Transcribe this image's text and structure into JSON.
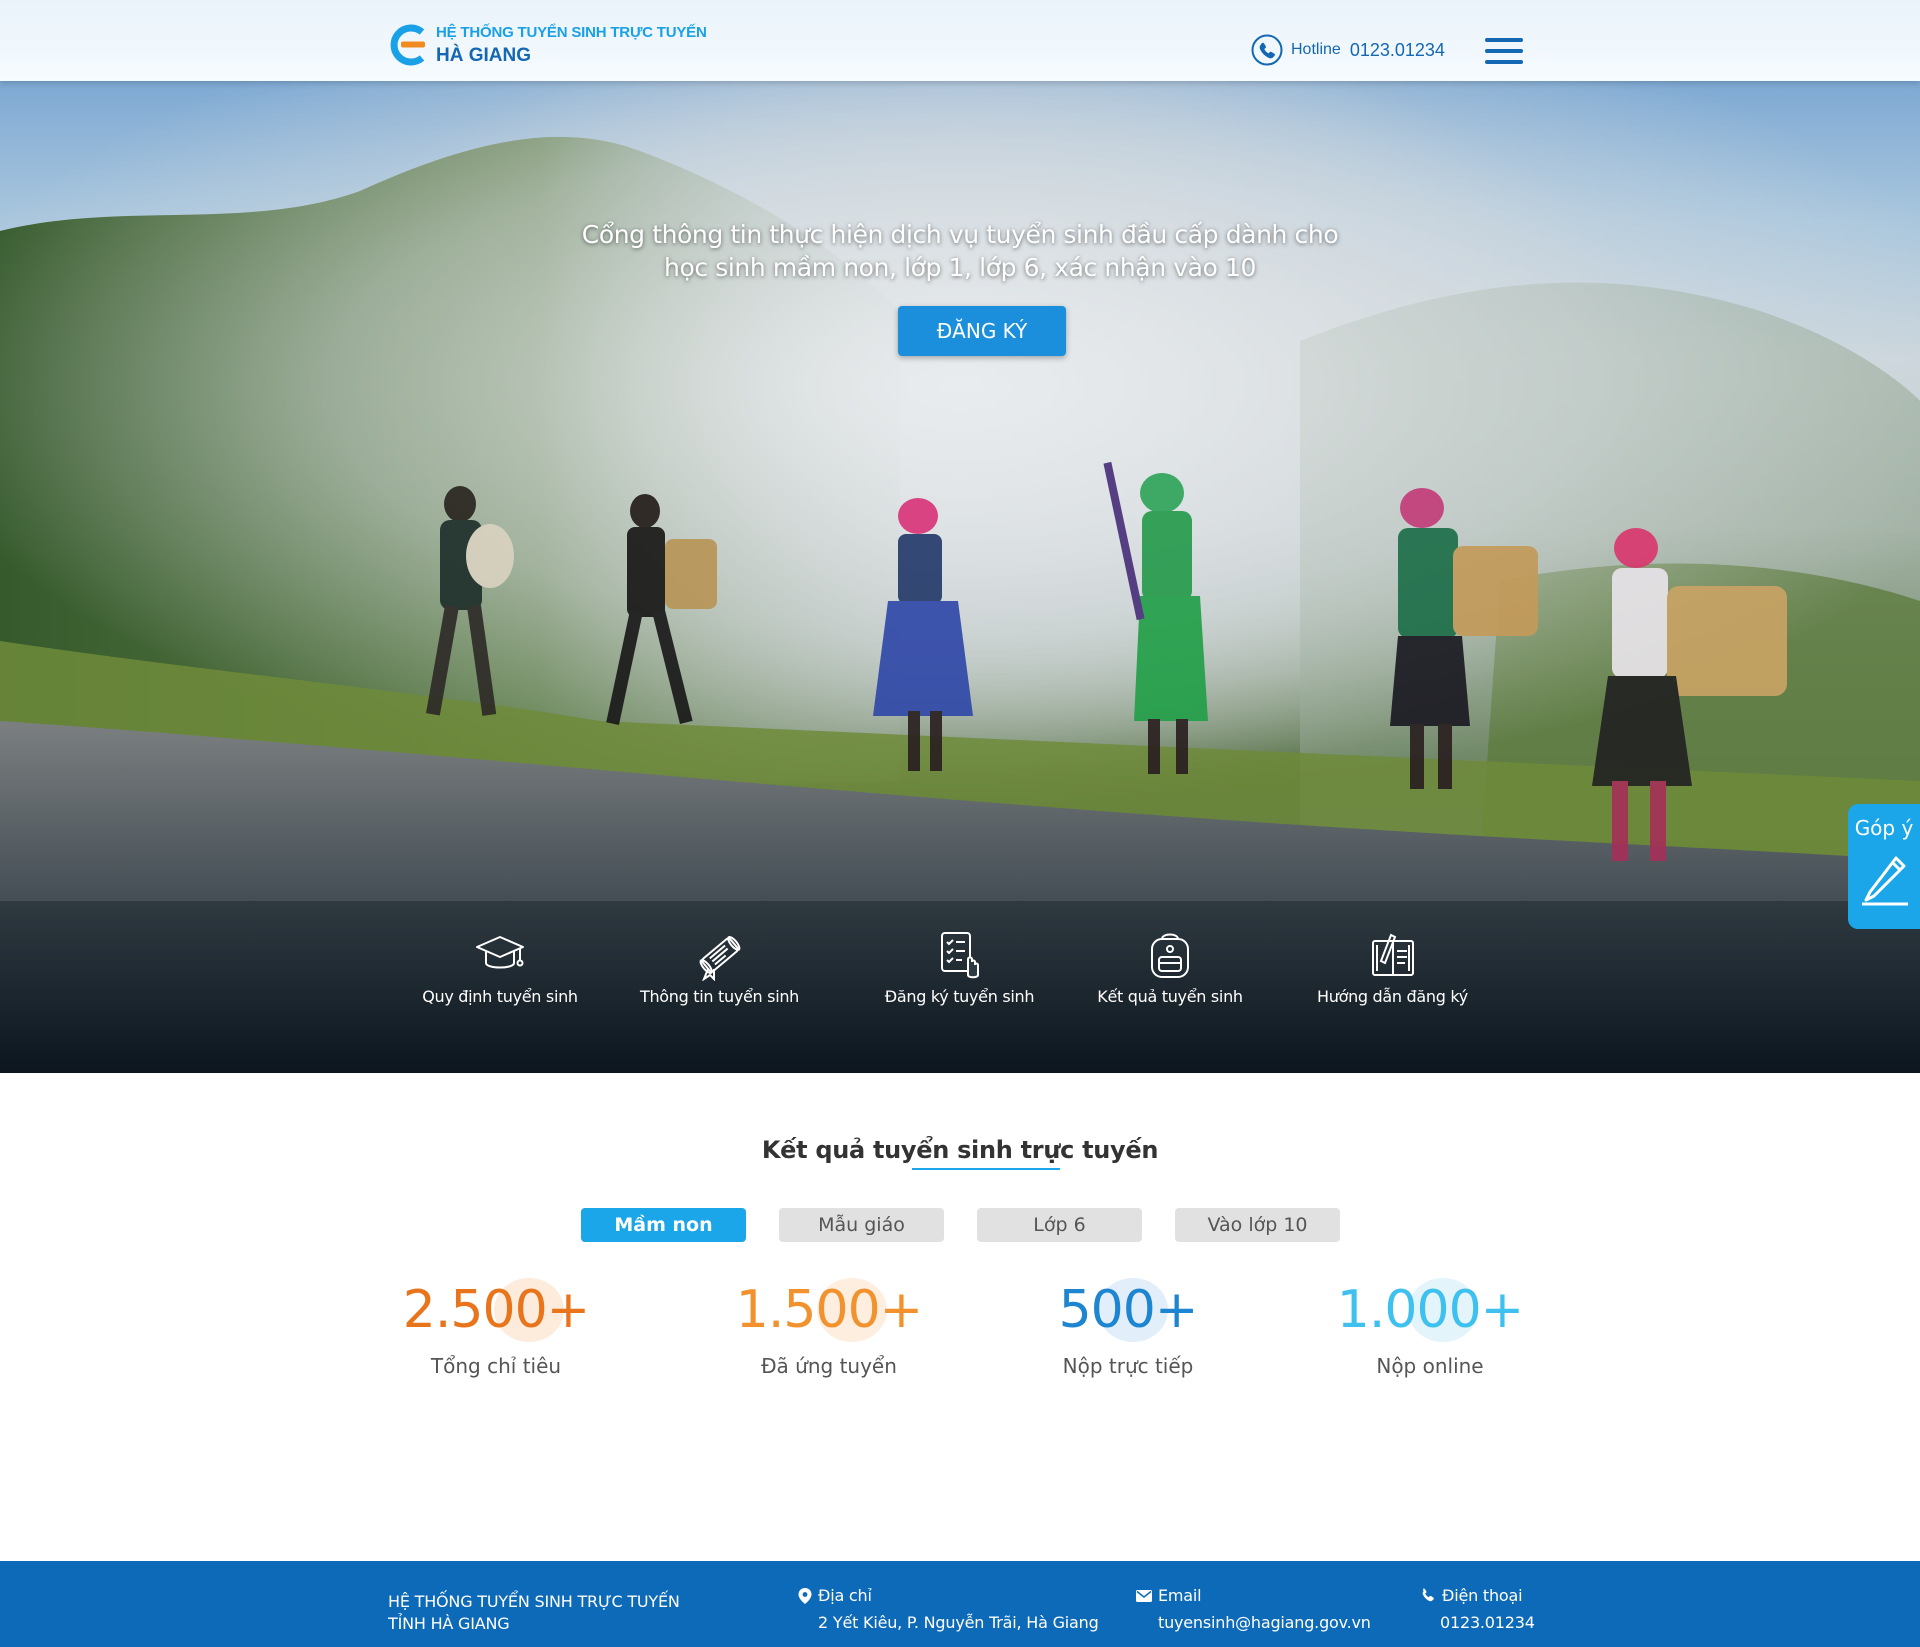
{
  "header": {
    "logo_line1": "HỆ THỐNG TUYỂN SINH TRỰC TUYẾN",
    "logo_line2": "HÀ GIANG",
    "hotline_label": "Hotline",
    "hotline_number": "0123.01234"
  },
  "hero": {
    "title": "Cổng thông tin thực hiện dịch vụ tuyển sinh đầu cấp dành cho học sinh mầm non, lớp 1, lớp 6, xác nhận vào 10",
    "register_button": "ĐĂNG KÝ",
    "quick_links": [
      {
        "label": "Quy định tuyển sinh",
        "icon": "graduation-cap-icon"
      },
      {
        "label": "Thông tin  tuyển sinh",
        "icon": "diploma-scroll-icon"
      },
      {
        "label": "Đăng ký tuyển sinh",
        "icon": "checklist-hand-icon"
      },
      {
        "label": "Kết quả tuyển sinh",
        "icon": "backpack-icon"
      },
      {
        "label": "Hướng dẫn đăng ký",
        "icon": "book-pencil-icon"
      }
    ]
  },
  "feedback": {
    "label": "Góp ý",
    "icon": "pencil-icon"
  },
  "results": {
    "title": "Kết quả tuyển sinh trực tuyến",
    "tabs": [
      {
        "label": "Mầm non",
        "active": true
      },
      {
        "label": "Mẫu giáo",
        "active": false
      },
      {
        "label": "Lớp 6",
        "active": false
      },
      {
        "label": "Vào lớp 10",
        "active": false
      }
    ],
    "stats": [
      {
        "value": "2.500+",
        "label": "Tổng chỉ tiêu",
        "color": "#e8741b"
      },
      {
        "value": "1.500+",
        "label": "Đã ứng tuyển",
        "color": "#f2922f"
      },
      {
        "value": "500+",
        "label": "Nộp trực tiếp",
        "color": "#1e86d0"
      },
      {
        "value": "1.000+",
        "label": "Nộp online",
        "color": "#3ec1ef"
      }
    ]
  },
  "footer": {
    "org_line1": "HỆ THỐNG TUYỂN SINH TRỰC TUYẾN",
    "org_line2": "TỈNH HÀ GIANG",
    "address_label": "Địa chỉ",
    "address_value": "2 Yết Kiêu, P. Nguyễn Trãi, Hà Giang",
    "email_label": "Email",
    "email_value": "tuyensinh@hagiang.gov.vn",
    "phone_label": "Điện thoại",
    "phone_value": "0123.01234"
  },
  "colors": {
    "brand_blue": "#1467b3",
    "accent_blue": "#1aa6e8",
    "footer_blue": "#0d6ab8"
  }
}
